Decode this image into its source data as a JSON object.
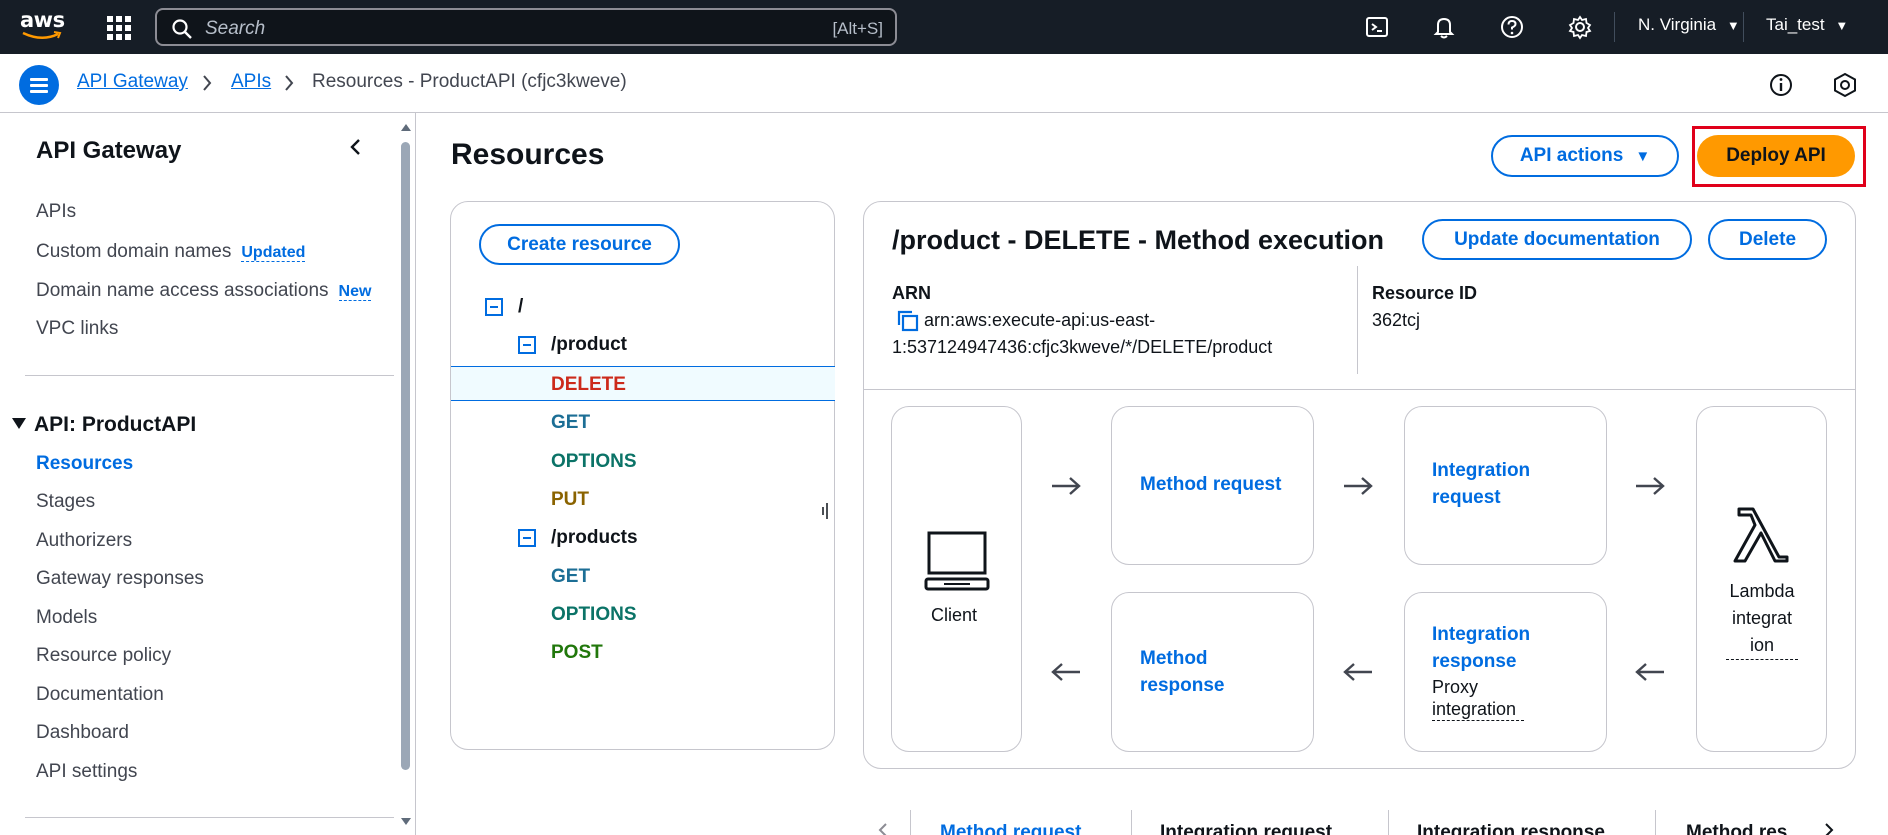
{
  "topnav": {
    "logo": "aws",
    "search_placeholder": "Search",
    "search_shortcut": "[Alt+S]",
    "region": "N. Virginia",
    "user": "Tai_test",
    "icons": [
      "cloudshell-icon",
      "bell-icon",
      "help-icon",
      "gear-icon"
    ]
  },
  "breadcrumb": {
    "items": [
      "API Gateway",
      "APIs",
      "Resources - ProductAPI (cfjc3kweve)"
    ]
  },
  "sidebar": {
    "title": "API Gateway",
    "top_items": [
      {
        "label": "APIs"
      },
      {
        "label": "Custom domain names",
        "badge": "Updated"
      },
      {
        "label": "Domain name access associations",
        "badge": "New"
      },
      {
        "label": "VPC links"
      }
    ],
    "section_title": "API: ProductAPI",
    "section_items": [
      "Resources",
      "Stages",
      "Authorizers",
      "Gateway responses",
      "Models",
      "Resource policy",
      "Documentation",
      "Dashboard",
      "API settings"
    ],
    "active_item": "Resources"
  },
  "main": {
    "title": "Resources",
    "api_actions_label": "API actions",
    "deploy_label": "Deploy API",
    "create_resource_label": "Create resource",
    "tree": {
      "root": "/",
      "product": "/product",
      "product_methods": [
        "DELETE",
        "GET",
        "OPTIONS",
        "PUT"
      ],
      "products": "/products",
      "products_methods": [
        "GET",
        "OPTIONS",
        "POST"
      ]
    },
    "execution": {
      "title": "/product - DELETE - Method execution",
      "update_doc_label": "Update documentation",
      "delete_label": "Delete",
      "arn_label": "ARN",
      "arn_line1": "arn:aws:execute-api:us-east-",
      "arn_line2": "1:537124947436:cfjc3kweve/*/DELETE/product",
      "resource_id_label": "Resource ID",
      "resource_id": "362tcj",
      "client_label": "Client",
      "method_request_l1": "Method request",
      "integration_request_l1": "Integration",
      "integration_request_l2": "request",
      "method_response_l1": "Method",
      "method_response_l2": "response",
      "integration_response_l1": "Integration",
      "integration_response_l2": "response",
      "integration_response_note_l1": "Proxy",
      "integration_response_note_l2": "integration",
      "lambda_l1": "Lambda",
      "lambda_l2": "integrat",
      "lambda_l3": "ion"
    },
    "bottom_tabs": [
      "Method request",
      "Integration request",
      "Integration response",
      "Method res"
    ]
  }
}
